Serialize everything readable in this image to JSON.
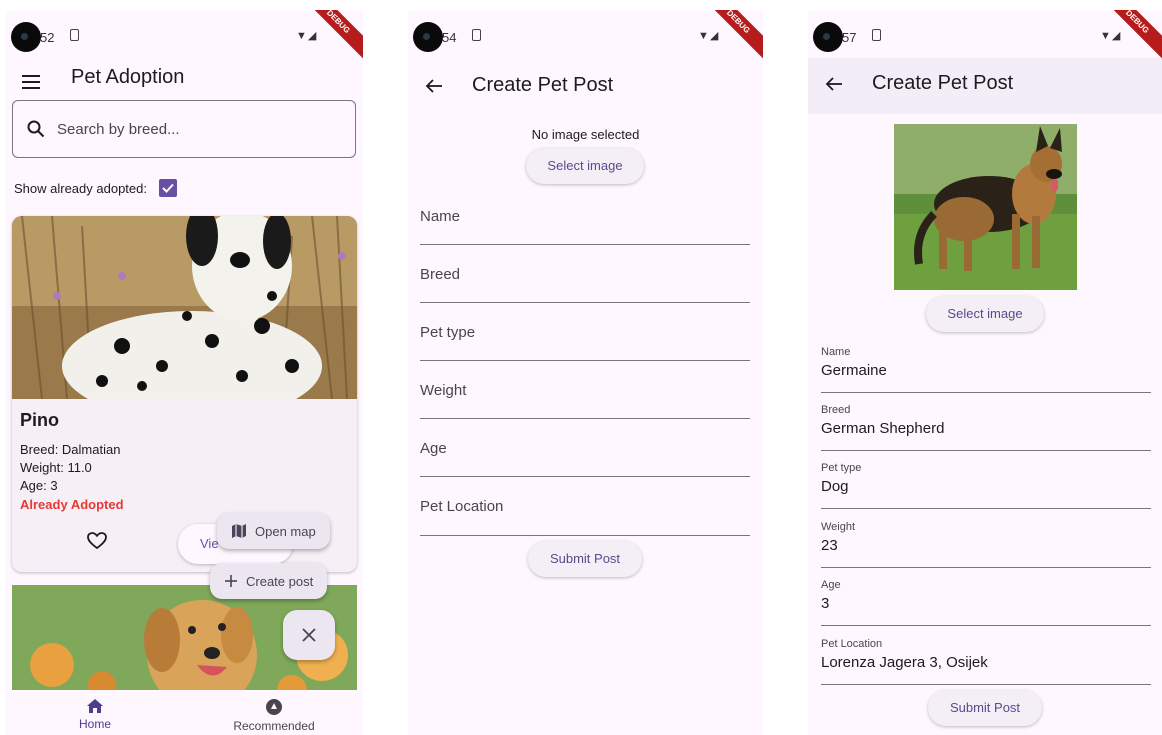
{
  "screen1": {
    "time": "52",
    "debug": "DEBUG",
    "title": "Pet Adoption",
    "search_placeholder": "Search by breed...",
    "show_adopted_label": "Show already adopted:",
    "card": {
      "name": "Pino",
      "breed": "Breed: Dalmatian",
      "weight": "Weight: 11.0",
      "age": "Age: 3",
      "status": "Already Adopted",
      "view_label": "Vie"
    },
    "fab": {
      "open_map": "Open map",
      "create_post": "Create post"
    },
    "nav": {
      "home": "Home",
      "recommended": "Recommended"
    }
  },
  "screen2": {
    "time": "54",
    "debug": "DEBUG",
    "title": "Create Pet Post",
    "no_image": "No image selected",
    "select_image": "Select image",
    "fields": [
      "Name",
      "Breed",
      "Pet type",
      "Weight",
      "Age",
      "Pet Location"
    ],
    "submit": "Submit Post"
  },
  "screen3": {
    "time": "57",
    "debug": "DEBUG",
    "title": "Create Pet Post",
    "select_image": "Select image",
    "fields": [
      {
        "label": "Name",
        "value": "Germaine"
      },
      {
        "label": "Breed",
        "value": "German Shepherd"
      },
      {
        "label": "Pet type",
        "value": "Dog"
      },
      {
        "label": "Weight",
        "value": "23"
      },
      {
        "label": "Age",
        "value": "3"
      },
      {
        "label": "Pet Location",
        "value": "Lorenza Jagera 3, Osijek"
      }
    ],
    "submit": "Submit Post"
  },
  "colors": {
    "accent": "#6750a4",
    "background": "#fef7ff",
    "adopted_red": "#e53935",
    "debug_banner": "#b71c1c"
  },
  "icons": [
    "menu-icon",
    "search-icon",
    "check-icon",
    "heart-icon",
    "map-icon",
    "plus-icon",
    "close-icon",
    "home-icon",
    "recommended-icon",
    "back-arrow-icon",
    "wifi-icon",
    "signal-icon",
    "sim-icon"
  ]
}
